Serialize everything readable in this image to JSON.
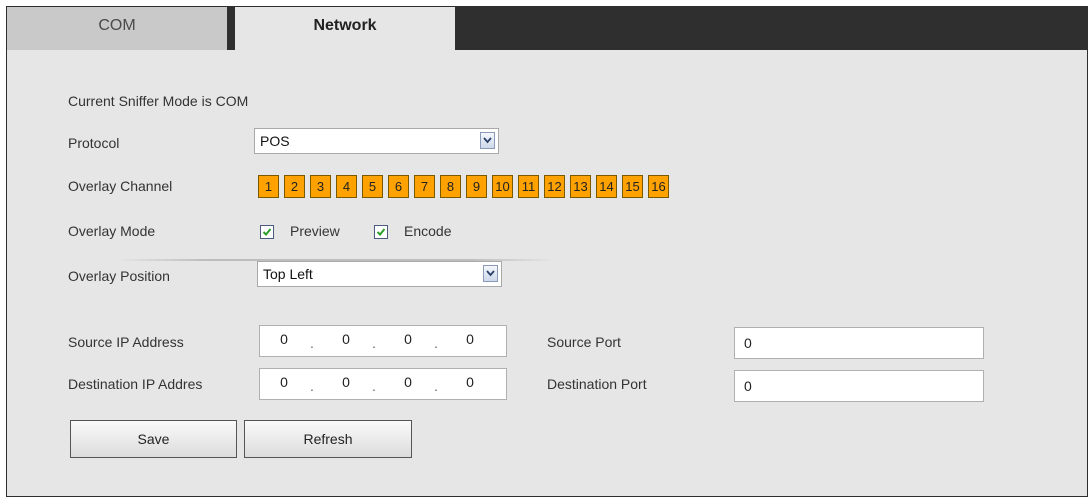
{
  "tabs": [
    {
      "label": "COM",
      "active": false
    },
    {
      "label": "Network",
      "active": true
    }
  ],
  "status_text": "Current Sniffer Mode is COM",
  "protocol": {
    "label": "Protocol",
    "value": "POS"
  },
  "overlay_channel": {
    "label": "Overlay Channel",
    "channels": [
      "1",
      "2",
      "3",
      "4",
      "5",
      "6",
      "7",
      "8",
      "9",
      "10",
      "11",
      "12",
      "13",
      "14",
      "15",
      "16"
    ],
    "color": "#ffa200"
  },
  "overlay_mode": {
    "label": "Overlay Mode",
    "preview": {
      "label": "Preview",
      "checked": true
    },
    "encode": {
      "label": "Encode",
      "checked": true
    }
  },
  "overlay_position": {
    "label": "Overlay Position",
    "value": "Top Left"
  },
  "source_ip": {
    "label": "Source IP Address",
    "octets": [
      "0",
      "0",
      "0",
      "0"
    ]
  },
  "dest_ip": {
    "label": "Destination IP Addres",
    "octets": [
      "0",
      "0",
      "0",
      "0"
    ]
  },
  "source_port": {
    "label": "Source Port",
    "value": "0"
  },
  "dest_port": {
    "label": "Destination Port",
    "value": "0"
  },
  "buttons": {
    "save": "Save",
    "refresh": "Refresh"
  }
}
